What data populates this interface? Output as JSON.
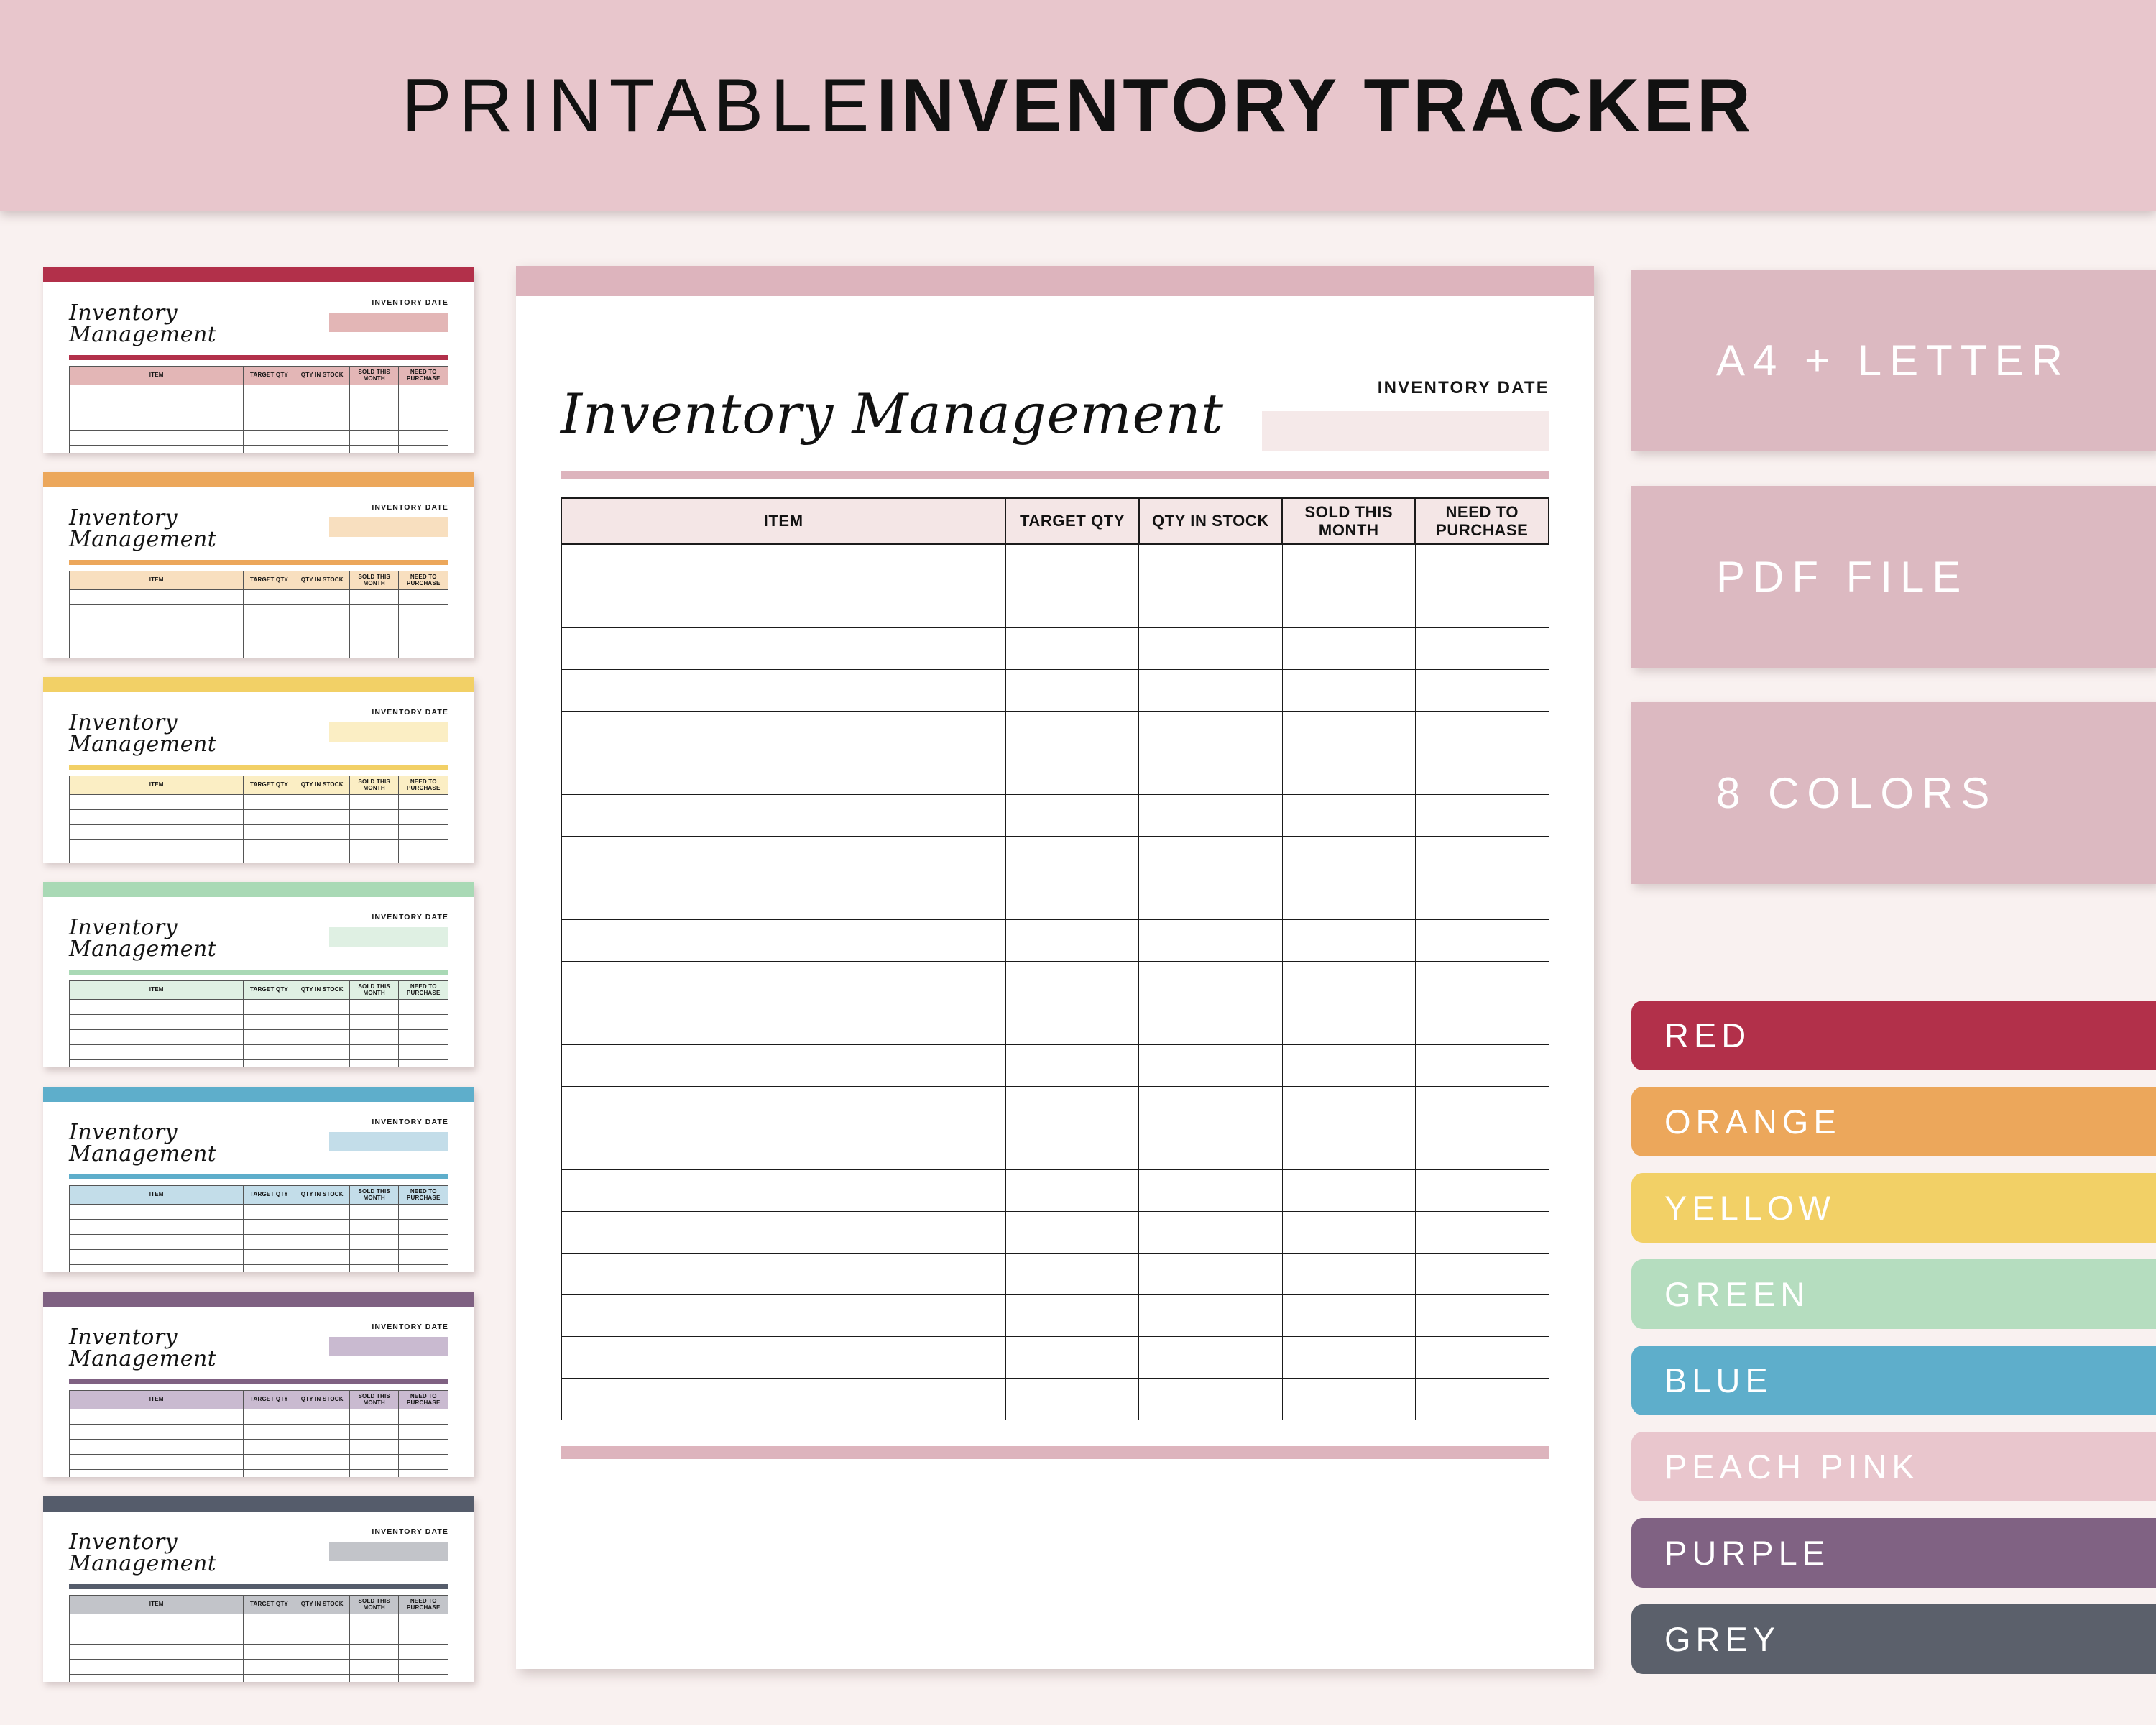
{
  "banner": {
    "title_thin": "PRINTABLE",
    "title_bold": "INVENTORY TRACKER",
    "background": "#e8c6cc"
  },
  "document": {
    "title": "Inventory Management",
    "date_label": "INVENTORY DATE",
    "accent": "#ddb4bd",
    "header_fill": "#f4e6e6",
    "date_box_fill": "#f5e9e9",
    "columns": [
      "ITEM",
      "TARGET QTY",
      "QTY IN STOCK",
      "SOLD THIS MONTH",
      "NEED TO PURCHASE"
    ],
    "row_count": 21
  },
  "thumbnails": [
    {
      "title": "Inventory Management",
      "date_label": "INVENTORY DATE",
      "color_name": "RED",
      "bar": "#b2304a",
      "tint": "#e3b6b6",
      "rule": "#b2304a"
    },
    {
      "title": "Inventory Management",
      "date_label": "INVENTORY DATE",
      "color_name": "ORANGE",
      "bar": "#eca75b",
      "tint": "#f8dfbf",
      "rule": "#eca75b"
    },
    {
      "title": "Inventory Management",
      "date_label": "INVENTORY DATE",
      "color_name": "YELLOW",
      "bar": "#f2d066",
      "tint": "#fbeec4",
      "rule": "#f2d066"
    },
    {
      "title": "Inventory Management",
      "date_label": "INVENTORY DATE",
      "color_name": "GREEN",
      "bar": "#a9d9b5",
      "tint": "#dff0e3",
      "rule": "#a9d9b5"
    },
    {
      "title": "Inventory Management",
      "date_label": "INVENTORY DATE",
      "color_name": "BLUE",
      "bar": "#5eaecb",
      "tint": "#c3dde9",
      "rule": "#5eaecb"
    },
    {
      "title": "Inventory Management",
      "date_label": "INVENTORY DATE",
      "color_name": "PURPLE",
      "bar": "#7f6182",
      "tint": "#c9bad0",
      "rule": "#7f6182"
    },
    {
      "title": "Inventory Management",
      "date_label": "INVENTORY DATE",
      "color_name": "GREY",
      "bar": "#555c6b",
      "tint": "#c2c4c9",
      "rule": "#555c6b"
    }
  ],
  "badges": [
    {
      "label": "A4 + LETTER",
      "background": "#dcb9c1"
    },
    {
      "label": "PDF FILE",
      "background": "#dcb9c1"
    },
    {
      "label": "8 COLORS",
      "background": "#dcb9c1"
    }
  ],
  "color_swatches": [
    {
      "label": "RED",
      "hex": "#b2304a"
    },
    {
      "label": "ORANGE",
      "hex": "#eca75b"
    },
    {
      "label": "YELLOW",
      "hex": "#f2d066"
    },
    {
      "label": "GREEN",
      "hex": "#b5ddbf"
    },
    {
      "label": "BLUE",
      "hex": "#5eaecb"
    },
    {
      "label": "PEACH PINK",
      "hex": "#e9c6cd"
    },
    {
      "label": "PURPLE",
      "hex": "#806283"
    },
    {
      "label": "GREY",
      "hex": "#5b606b"
    }
  ]
}
